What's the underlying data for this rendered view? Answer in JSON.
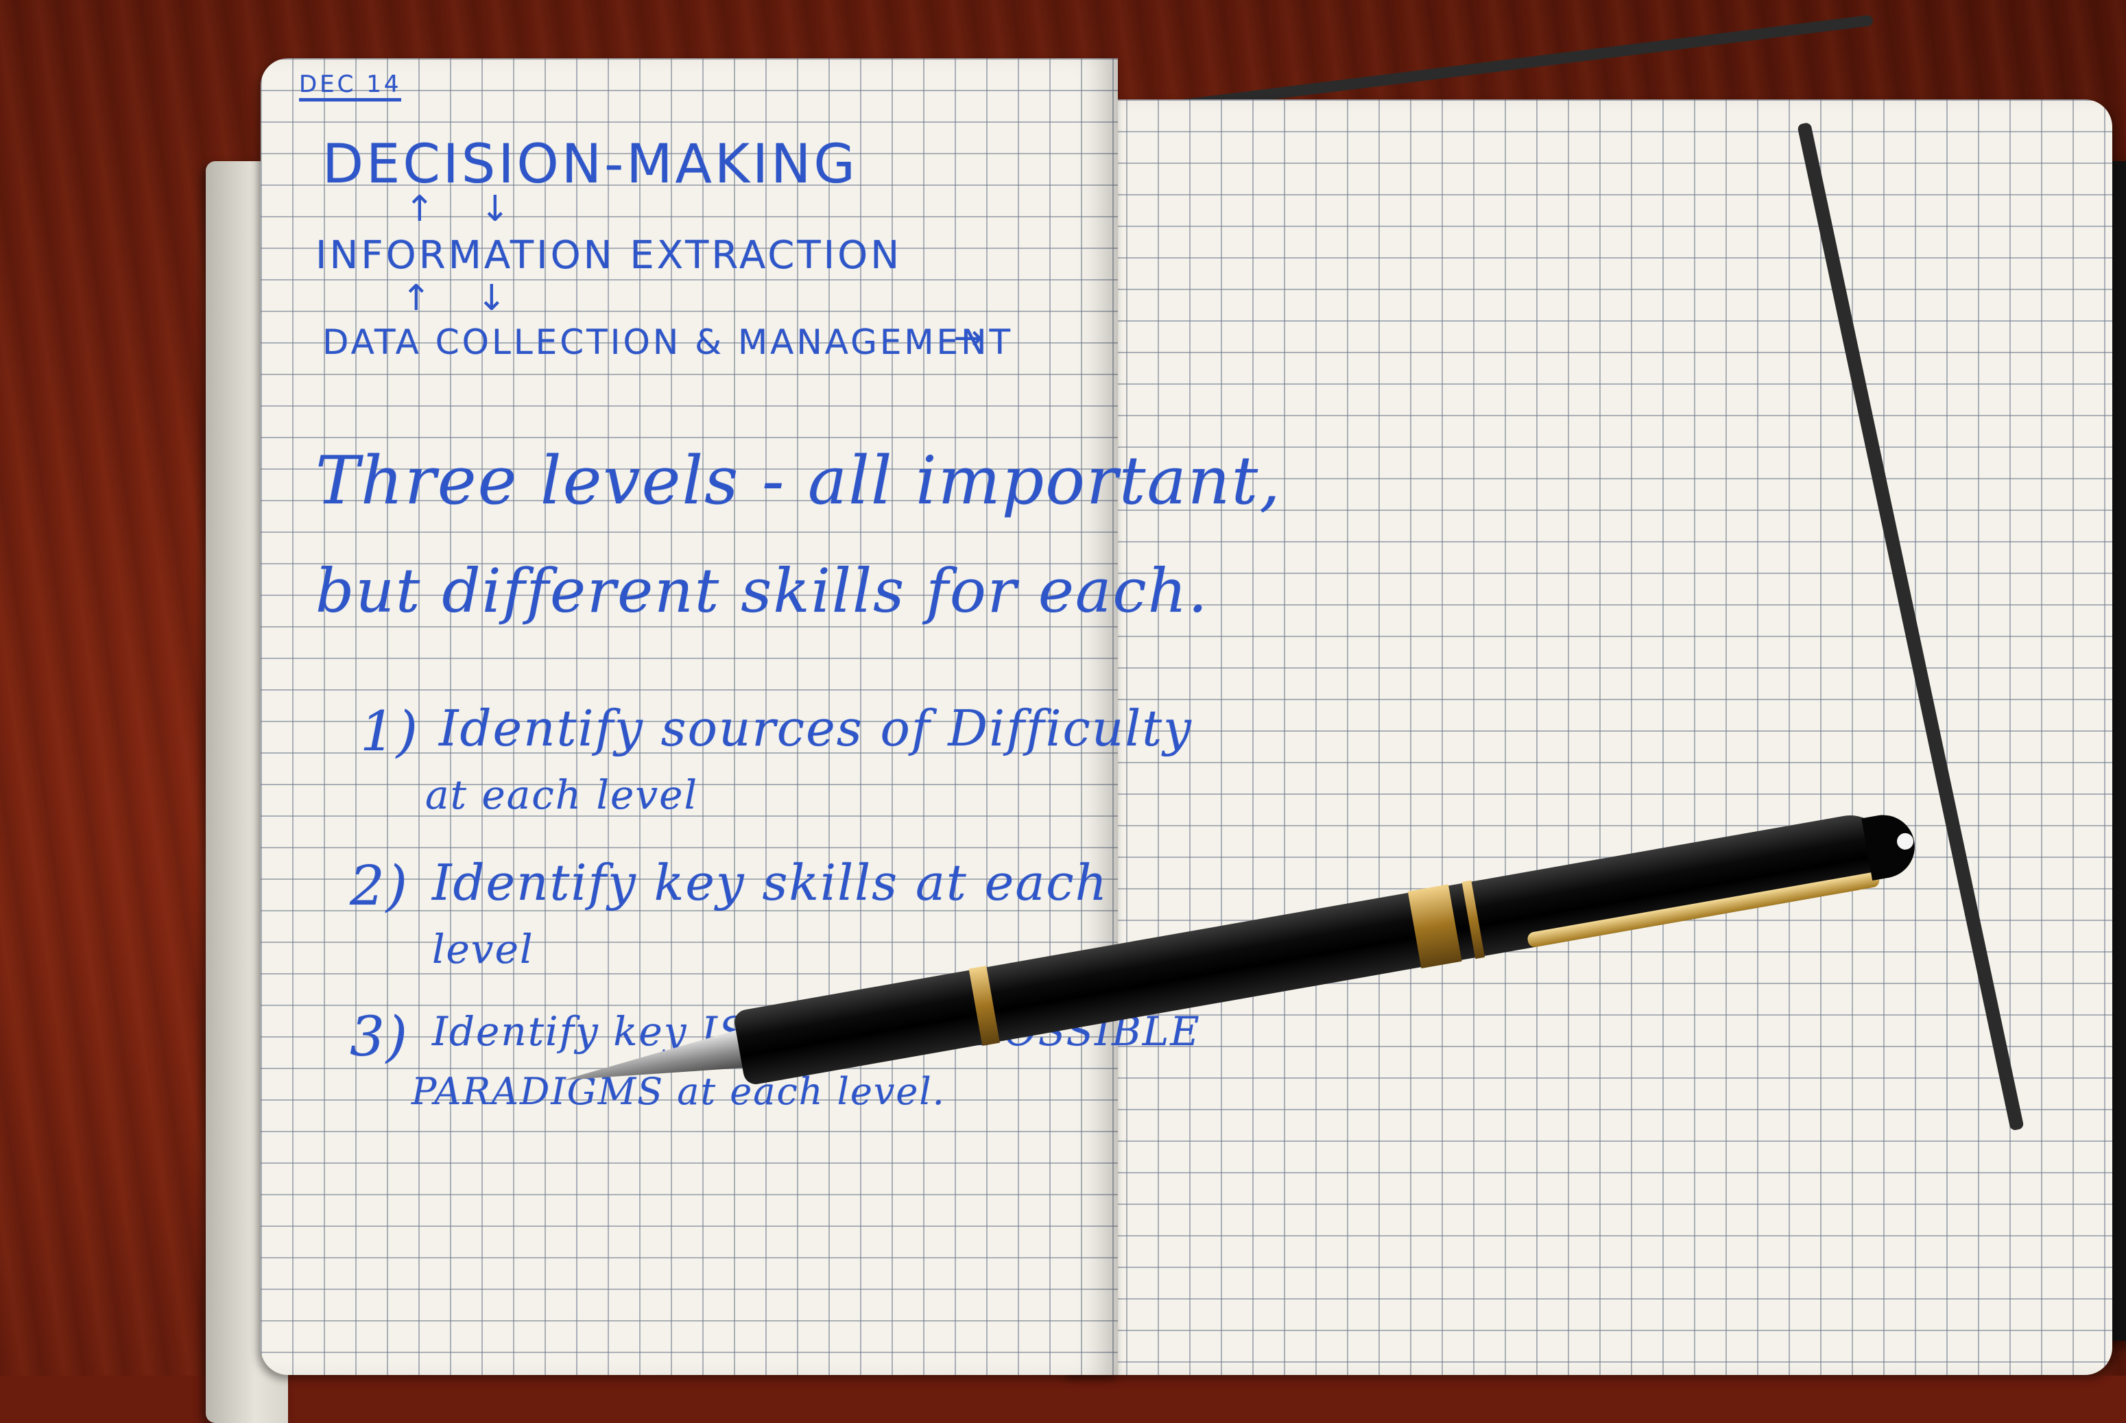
{
  "notes": {
    "header": "DEC 14",
    "levels": {
      "top": "DECISION-MAKING",
      "middle": "INFORMATION EXTRACTION",
      "bottom": "DATA COLLECTION & MANAGEMENT"
    },
    "arrows": {
      "up": "↑",
      "down": "↓",
      "right": "→"
    },
    "paragraph_line1": "Three levels - all important,",
    "paragraph_line2": "but different skills for each.",
    "items": [
      {
        "number": "1)",
        "line1": "Identify sources of Difficulty",
        "line2": "at each level"
      },
      {
        "number": "2)",
        "line1": "Identify key skills at each",
        "line2": "level"
      },
      {
        "number": "3)",
        "line1": "Identify key ISSUES and POSSIBLE",
        "line2": "PARADIGMS at each level."
      }
    ]
  },
  "colors": {
    "ink": "#2f56c8",
    "paper": "#f4f2ea",
    "desk": "#6a1c0d"
  }
}
